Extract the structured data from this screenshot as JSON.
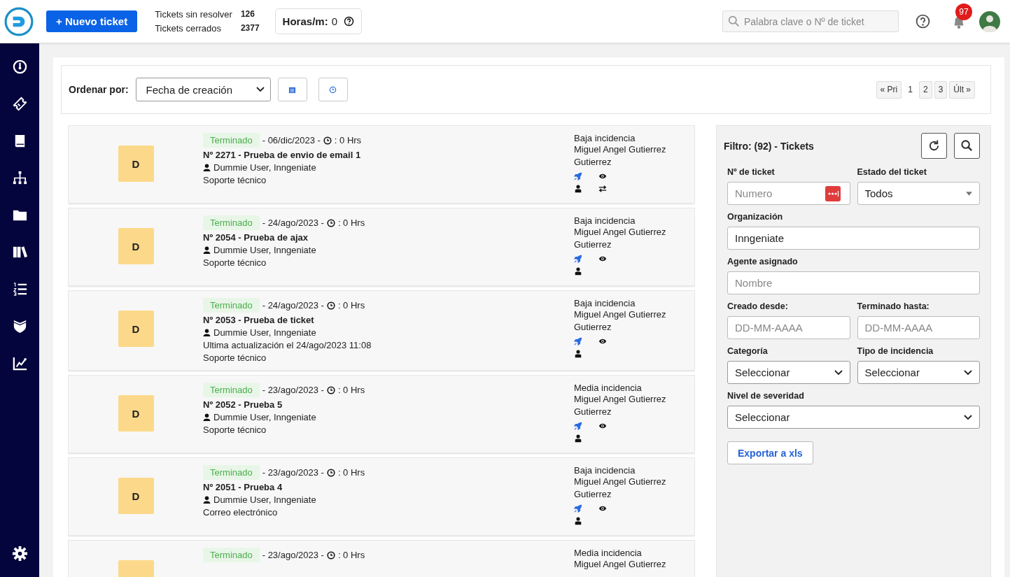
{
  "header": {
    "new_ticket": "+ Nuevo ticket",
    "stats": [
      {
        "label": "Tickets sin resolver",
        "value": "126"
      },
      {
        "label": "Tickets cerrados",
        "value": "2377"
      }
    ],
    "hours": {
      "label": "Horas/m:",
      "value": "0"
    },
    "search": {
      "placeholder": "Palabra clave o Nº de ticket"
    },
    "notifications": "97"
  },
  "sidebar": {
    "items": [
      {
        "kind": "gauge"
      },
      {
        "kind": "ticket"
      },
      {
        "kind": "book"
      },
      {
        "kind": "tree"
      },
      {
        "kind": "folder"
      },
      {
        "kind": "library"
      },
      {
        "kind": "list"
      },
      {
        "kind": "shield"
      },
      {
        "kind": "chart"
      }
    ],
    "bottom": {
      "kind": "gear"
    }
  },
  "toolbar": {
    "sort_label": "Ordenar por:",
    "sort_value": "Fecha de creación",
    "pagination": [
      {
        "label": "« Pri",
        "selected": false
      },
      {
        "label": "1",
        "selected": true
      },
      {
        "label": "2",
        "selected": false
      },
      {
        "label": "3",
        "selected": false
      },
      {
        "label": "Últ »",
        "selected": false
      }
    ]
  },
  "tickets": [
    {
      "initial": "D",
      "status": "Terminado",
      "date": "- 06/dic/2023 -",
      "hours": ": 0 Hrs",
      "title": "Nº 2271 - Prueba de envio de email 1",
      "user": "Dummie User, Inngeniate",
      "lines": [
        "Soporte técnico"
      ],
      "priority": "Baja incidencia",
      "agent": "Miguel Angel Gutierrez Gutierrez",
      "transfer": true
    },
    {
      "initial": "D",
      "status": "Terminado",
      "date": "- 24/ago/2023 -",
      "hours": ": 0 Hrs",
      "title": "Nº 2054 - Prueba de ajax",
      "user": "Dummie User, Inngeniate",
      "lines": [
        "Soporte técnico"
      ],
      "priority": "Baja incidencia",
      "agent": "Miguel Angel Gutierrez Gutierrez",
      "transfer": false
    },
    {
      "initial": "D",
      "status": "Terminado",
      "date": "- 24/ago/2023 -",
      "hours": ": 0 Hrs",
      "title": "Nº 2053 - Prueba de ticket",
      "user": "Dummie User, Inngeniate",
      "lines": [
        "Ultima actualización el 24/ago/2023 11:08",
        "Soporte técnico"
      ],
      "priority": "Baja incidencia",
      "agent": "Miguel Angel Gutierrez Gutierrez",
      "transfer": false
    },
    {
      "initial": "D",
      "status": "Terminado",
      "date": "- 23/ago/2023 -",
      "hours": ": 0 Hrs",
      "title": "Nº 2052 - Prueba 5",
      "user": "Dummie User, Inngeniate",
      "lines": [
        "Soporte técnico"
      ],
      "priority": "Media incidencia",
      "agent": "Miguel Angel Gutierrez Gutierrez",
      "transfer": false
    },
    {
      "initial": "D",
      "status": "Terminado",
      "date": "- 23/ago/2023 -",
      "hours": ": 0 Hrs",
      "title": "Nº 2051 - Prueba 4",
      "user": "Dummie User, Inngeniate",
      "lines": [
        "Correo electrónico"
      ],
      "priority": "Baja incidencia",
      "agent": "Miguel Angel Gutierrez Gutierrez",
      "transfer": false
    },
    {
      "status": "Terminado",
      "date": "- 23/ago/2023 -",
      "hours": ": 0 Hrs",
      "priority": "Media incidencia",
      "agent": "Miguel Angel Gutierrez"
    }
  ],
  "filter": {
    "title": "Filtro: (92) - Tickets",
    "ticket_number": {
      "label": "Nº de ticket",
      "placeholder": "Numero"
    },
    "status": {
      "label": "Estado del ticket",
      "value": "Todos"
    },
    "organization": {
      "label": "Organización",
      "value": "Inngeniate"
    },
    "agent": {
      "label": "Agente asignado",
      "placeholder": "Nombre"
    },
    "created_from": {
      "label": "Creado desde:",
      "placeholder": "DD-MM-AAAA"
    },
    "finished_to": {
      "label": "Terminado hasta:",
      "placeholder": "DD-MM-AAAA"
    },
    "category": {
      "label": "Categoría",
      "value": "Seleccionar"
    },
    "incident_type": {
      "label": "Tipo de incidencia",
      "value": "Seleccionar"
    },
    "severity": {
      "label": "Nivel de severidad",
      "value": "Seleccionar"
    },
    "export": "Exportar a xls"
  }
}
